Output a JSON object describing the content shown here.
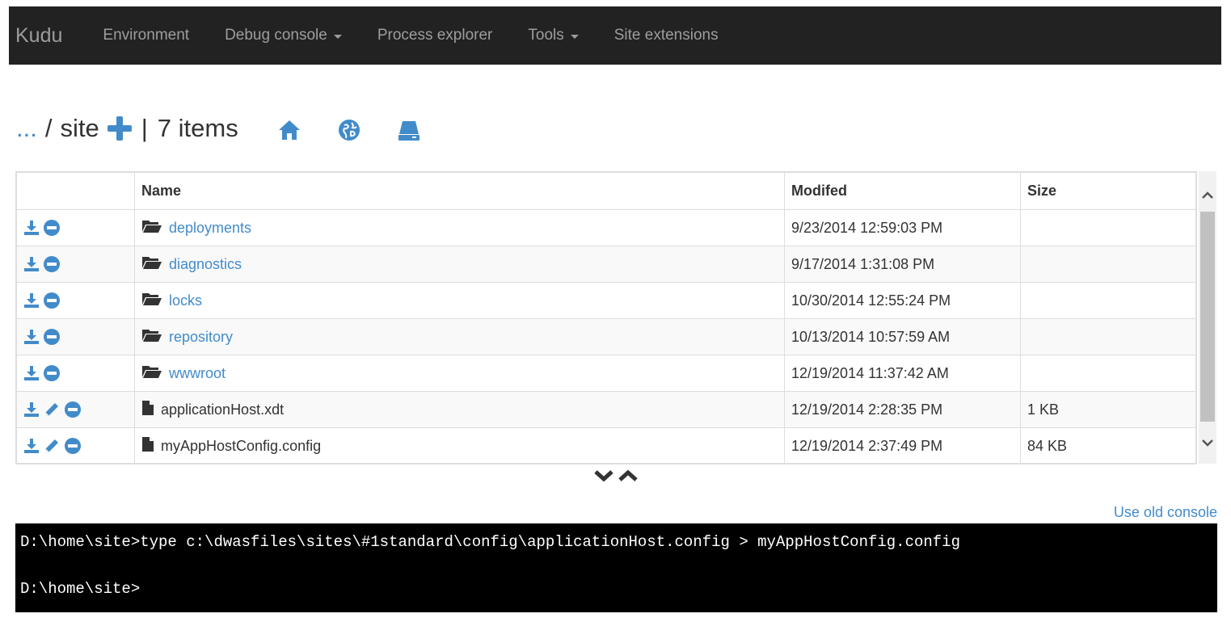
{
  "navbar": {
    "brand": "Kudu",
    "items": [
      {
        "label": "Environment",
        "dropdown": false
      },
      {
        "label": "Debug console",
        "dropdown": true
      },
      {
        "label": "Process explorer",
        "dropdown": false
      },
      {
        "label": "Tools",
        "dropdown": true
      },
      {
        "label": "Site extensions",
        "dropdown": false
      }
    ]
  },
  "breadcrumb": {
    "parent": "...",
    "separator": "/",
    "current": "site",
    "pipe": "|",
    "item_count": "7 items"
  },
  "table": {
    "headers": {
      "actions": "",
      "name": "Name",
      "modified": "Modifed",
      "size": "Size"
    },
    "rows": [
      {
        "type": "folder",
        "name": "deployments",
        "modified": "9/23/2014 12:59:03 PM",
        "size": ""
      },
      {
        "type": "folder",
        "name": "diagnostics",
        "modified": "9/17/2014 1:31:08 PM",
        "size": ""
      },
      {
        "type": "folder",
        "name": "locks",
        "modified": "10/30/2014 12:55:24 PM",
        "size": ""
      },
      {
        "type": "folder",
        "name": "repository",
        "modified": "10/13/2014 10:57:59 AM",
        "size": ""
      },
      {
        "type": "folder",
        "name": "wwwroot",
        "modified": "12/19/2014 11:37:42 AM",
        "size": ""
      },
      {
        "type": "file",
        "name": "applicationHost.xdt",
        "modified": "12/19/2014 2:28:35 PM",
        "size": "1 KB"
      },
      {
        "type": "file",
        "name": "myAppHostConfig.config",
        "modified": "12/19/2014 2:37:49 PM",
        "size": "84 KB"
      }
    ]
  },
  "old_console_label": "Use old console",
  "console": {
    "lines": [
      "D:\\home\\site>type c:\\dwasfiles\\sites\\#1standard\\config\\applicationHost.config > myAppHostConfig.config",
      "",
      "D:\\home\\site>"
    ]
  },
  "colors": {
    "navbar_bg": "#222222",
    "navbar_text": "#9d9d9d",
    "accent": "#428bca",
    "console_bg": "#000000"
  }
}
